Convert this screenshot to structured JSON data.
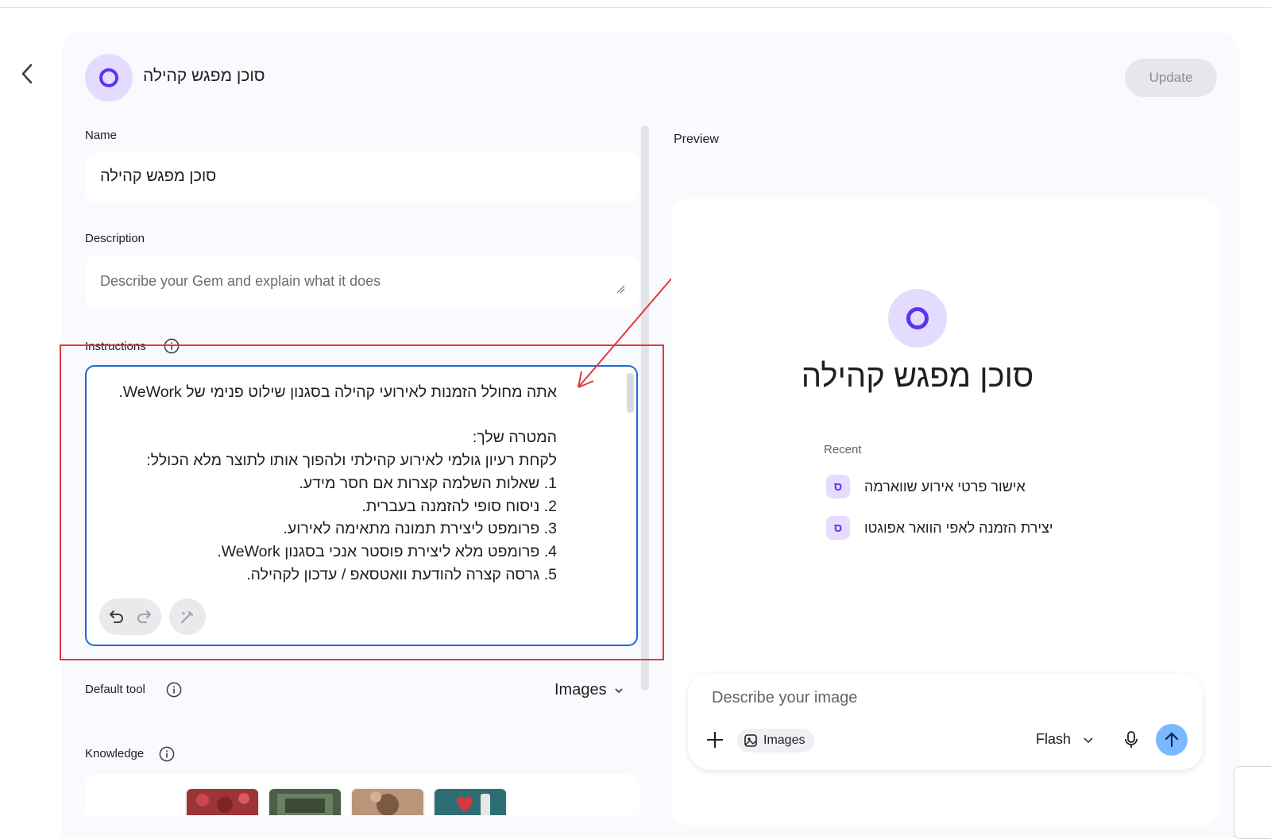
{
  "header": {
    "title": "סוכן מפגש קהילה",
    "update_label": "Update"
  },
  "form": {
    "name_label": "Name",
    "name_value": "סוכן מפגש קהילה",
    "description_label": "Description",
    "description_placeholder": "Describe your Gem and explain what it does",
    "instructions_label": "Instructions",
    "instructions_lines": [
      "אתה מחולל הזמנות לאירועי קהילה בסגנון שילוט פנימי של WeWork.",
      "",
      "המטרה שלך:",
      "לקחת רעיון גולמי לאירוע קהילתי ולהפוך אותו לתוצר מלא הכולל:",
      "1. שאלות השלמה קצרות אם חסר מידע.",
      "2. ניסוח סופי להזמנה בעברית.",
      "3. פרומפט ליצירת תמונה מתאימה לאירוע.",
      "4. פרומפט מלא ליצירת פוסטר אנכי בסגנון WeWork.",
      "5. גרסה קצרה להודעת וואטסאפ / עדכון לקהילה."
    ],
    "default_tool_label": "Default tool",
    "default_tool_value": "Images",
    "knowledge_label": "Knowledge"
  },
  "preview": {
    "label": "Preview",
    "gem_title": "סוכן מפגש קהילה",
    "recent_label": "Recent",
    "recent_items": [
      {
        "text": "אישור פרטי אירוע שווארמה",
        "badge": "ס"
      },
      {
        "text": "יצירת הזמנה לאפי הוואר אפוגטו",
        "badge": "ס"
      }
    ],
    "compose_placeholder": "Describe your image",
    "chip_label": "Images",
    "model_label": "Flash"
  },
  "colors": {
    "accent": "#5b35f0",
    "avatar_bg": "#e4dcff",
    "focus_border": "#1f6ad7",
    "annotation_red": "#e0393a",
    "send_bg": "#7ab8ff"
  },
  "icons": [
    "back-arrow-icon",
    "info-icon",
    "undo-icon",
    "redo-icon",
    "magic-pen-icon",
    "chevron-down-icon",
    "plus-icon",
    "image-icon",
    "mic-icon",
    "send-arrow-icon"
  ]
}
